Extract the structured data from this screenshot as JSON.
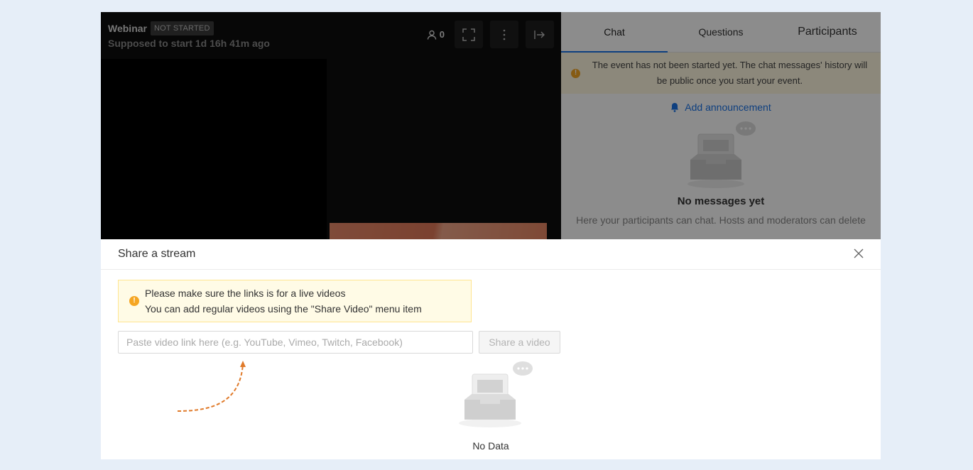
{
  "stage": {
    "title": "Webinar",
    "status_badge": "NOT STARTED",
    "subtitle": "Supposed to start 1d 16h 41m ago",
    "participants_count": "0"
  },
  "side": {
    "tabs": [
      {
        "label": "Chat",
        "active": true
      },
      {
        "label": "Questions",
        "active": false
      },
      {
        "label": "Participants",
        "active": false
      }
    ],
    "notice": "The event has not been started yet. The chat messages' history will be public once you start your event.",
    "add_announcement": "Add announcement",
    "empty_title": "No messages yet",
    "empty_sub": "Here your participants can chat. Hosts and moderators can delete"
  },
  "modal": {
    "title": "Share a stream",
    "alert_line1": "Please make sure the links is for a live videos",
    "alert_line2": "You can add regular videos using the \"Share Video\" menu item",
    "input_placeholder": "Paste video link here (e.g. YouTube, Vimeo, Twitch, Facebook)",
    "share_button": "Share a video",
    "empty_text": "No Data"
  },
  "colors": {
    "accent": "#1a73e8",
    "warning": "#f5a623",
    "arrow": "#e07a2a"
  }
}
